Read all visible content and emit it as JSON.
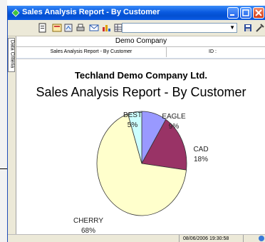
{
  "window": {
    "title": "Sales Analysis Report - By Customer"
  },
  "sidebar": {
    "tab_label": "Data Criteria"
  },
  "report": {
    "company_header": "Demo Company",
    "subtitle_header": "Sales Analysis Report - By Customer",
    "id_label": "ID :",
    "company_title": "Techland Demo Company Ltd.",
    "report_title": "Sales Analysis Report - By Customer"
  },
  "chart_data": {
    "type": "pie",
    "slices": [
      {
        "label": "EAGLE",
        "value_label": "9%",
        "value": 9,
        "color": "#9999ff"
      },
      {
        "label": "CAD",
        "value_label": "18%",
        "value": 18,
        "color": "#993366"
      },
      {
        "label": "CHERRY",
        "value_label": "68%",
        "value": 68,
        "color": "#ffffcc"
      },
      {
        "label": "BEST",
        "value_label": "5%",
        "value": 5,
        "color": "#ccffff"
      }
    ]
  },
  "status": {
    "datetime": "08/06/2006 19:30:58"
  },
  "colors": {
    "titlebar": "#0a5ae0",
    "toolbar": "#ece9d8"
  },
  "toolbar": {
    "icons": [
      "page-setup-icon",
      "print-preview-icon",
      "export-icon",
      "print-icon",
      "email-icon",
      "chart-icon",
      "grid-icon",
      "save-icon",
      "tools-icon"
    ]
  }
}
